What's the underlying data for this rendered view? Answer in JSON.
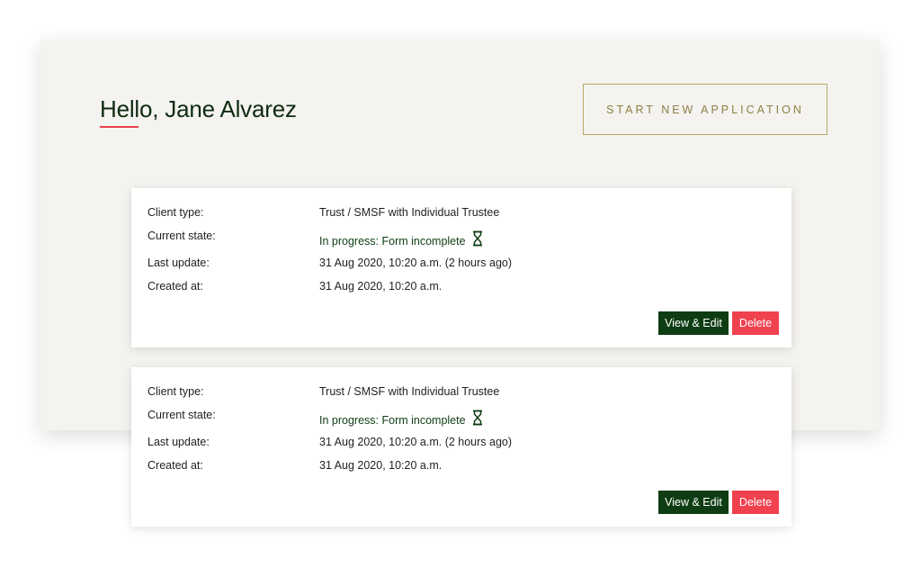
{
  "header": {
    "greeting": "Hello, Jane Alvarez",
    "start_button_label": "START NEW APPLICATION"
  },
  "labels": {
    "client_type": "Client type:",
    "current_state": "Current state:",
    "last_update": "Last update:",
    "created_at": "Created at:"
  },
  "applications": [
    {
      "client_type": "Trust / SMSF with Individual Trustee",
      "current_state": "In progress: Form incomplete",
      "state_icon": "hourglass-icon",
      "last_update": "31 Aug 2020, 10:20 a.m. (2 hours ago)",
      "created_at": "31 Aug 2020, 10:20 a.m.",
      "view_label": "View & Edit",
      "delete_label": "Delete"
    },
    {
      "client_type": "Trust / SMSF with Individual Trustee",
      "current_state": "In progress: Form incomplete",
      "state_icon": "hourglass-icon",
      "last_update": "31 Aug 2020, 10:20 a.m. (2 hours ago)",
      "created_at": "31 Aug 2020, 10:20 a.m.",
      "view_label": "View & Edit",
      "delete_label": "Delete"
    }
  ],
  "colors": {
    "panel_bg": "#f4f3ef",
    "dark_green": "#0e3d13",
    "accent_red": "#f0414f",
    "gold": "#b6a86b"
  }
}
